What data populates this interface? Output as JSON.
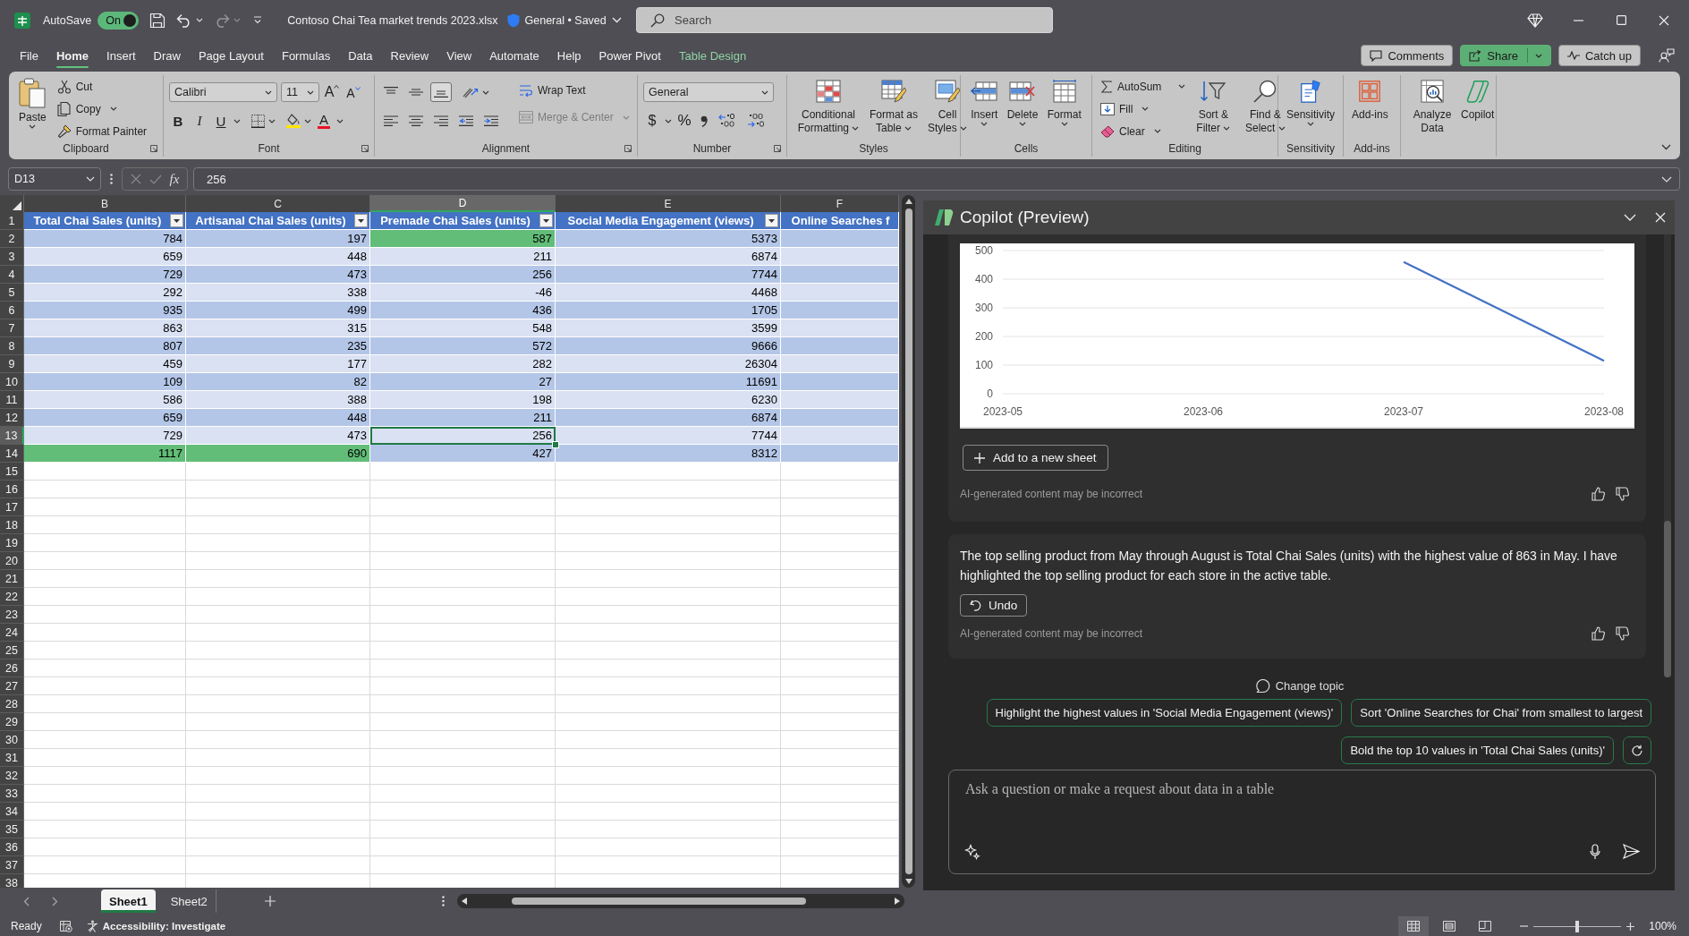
{
  "title_bar": {
    "autosave_label": "AutoSave",
    "autosave_toggle": {
      "label": "On",
      "on": true
    },
    "quick_access": [
      {
        "kind": "save",
        "disabled": false
      },
      {
        "kind": "undo",
        "disabled": false
      },
      {
        "kind": "redo",
        "disabled": true
      }
    ],
    "file_name": "Contoso Chai Tea market trends 2023.xlsx",
    "document_status": "General • Saved",
    "search": {
      "placeholder": "Search"
    }
  },
  "menu_tabs": [
    {
      "label": "File",
      "selected": false,
      "kind": "tab"
    },
    {
      "label": "Home",
      "selected": true,
      "kind": "tab"
    },
    {
      "label": "Insert",
      "selected": false,
      "kind": "tab"
    },
    {
      "label": "Draw",
      "selected": false,
      "kind": "tab"
    },
    {
      "label": "Page Layout",
      "selected": false,
      "kind": "tab"
    },
    {
      "label": "Formulas",
      "selected": false,
      "kind": "tab"
    },
    {
      "label": "Data",
      "selected": false,
      "kind": "tab"
    },
    {
      "label": "Review",
      "selected": false,
      "kind": "tab"
    },
    {
      "label": "View",
      "selected": false,
      "kind": "tab"
    },
    {
      "label": "Automate",
      "selected": false,
      "kind": "tab"
    },
    {
      "label": "Help",
      "selected": false,
      "kind": "tab"
    },
    {
      "label": "Power Pivot",
      "selected": false,
      "kind": "tab"
    },
    {
      "label": "Table Design",
      "selected": false,
      "kind": "contextual"
    }
  ],
  "header_buttons": {
    "comments": "Comments",
    "share": "Share",
    "catch_up": "Catch up"
  },
  "ribbon": {
    "clipboard": {
      "label": "Clipboard",
      "paste": "Paste",
      "cut": "Cut",
      "copy": "Copy",
      "format_painter": "Format Painter"
    },
    "font": {
      "label": "Font",
      "font_name": "Calibri",
      "font_size": "11",
      "grow_font": "A",
      "shrink_font": "A",
      "bold": "B",
      "italic": "I",
      "underline": "U",
      "font_color": "A"
    },
    "alignment": {
      "label": "Alignment",
      "vertical_align": [
        {
          "kind": "top",
          "selected": false
        },
        {
          "kind": "middle",
          "selected": false
        },
        {
          "kind": "bottom",
          "selected": true
        }
      ],
      "wrap_text": {
        "label": "Wrap Text",
        "disabled": false
      },
      "merge_center": {
        "label": "Merge & Center",
        "disabled": true
      }
    },
    "number": {
      "label": "Number",
      "format": "General",
      "currency": "$",
      "percent": "%"
    },
    "styles": {
      "label": "Styles",
      "buttons": [
        {
          "label": "Conditional Formatting",
          "kind": "conditional"
        },
        {
          "label": "Format as Table",
          "kind": "table"
        },
        {
          "label": "Cell Styles",
          "kind": "cell_styles"
        }
      ]
    },
    "cells": {
      "label": "Cells",
      "buttons": [
        {
          "label": "Insert",
          "kind": "insert"
        },
        {
          "label": "Delete",
          "kind": "delete"
        },
        {
          "label": "Format",
          "kind": "format"
        }
      ]
    },
    "editing": {
      "label": "Editing",
      "autosum": "AutoSum",
      "fill": "Fill",
      "clear": "Clear",
      "sort_filter": "Sort & Filter",
      "find_select": "Find & Select"
    },
    "sensitivity": {
      "label": "Sensitivity",
      "button": "Sensitivity"
    },
    "add_ins": {
      "label": "Add-ins",
      "button": "Add-ins"
    },
    "analysis": {
      "analyze_data": "Analyze Data",
      "copilot": "Copilot"
    }
  },
  "formula_bar": {
    "name_box": "D13",
    "function_label": "fx",
    "value": "256"
  },
  "sheet": {
    "column_letters": [
      "B",
      "C",
      "D",
      "E",
      "F"
    ],
    "header_row_number": "1",
    "headers": [
      {
        "label": "Total Chai Sales (units)",
        "filter": true
      },
      {
        "label": "Artisanal Chai Sales (units)",
        "filter": true
      },
      {
        "label": "Premade Chai Sales (units)",
        "filter": true
      },
      {
        "label": "Social Media Engagement (views)",
        "filter": true
      },
      {
        "label": "Online Searches f",
        "filter": false
      }
    ],
    "rows": [
      {
        "row_number": "2",
        "cells": [
          {
            "value": "784",
            "highlighted": false,
            "selected": false
          },
          {
            "value": "197",
            "highlighted": false,
            "selected": false
          },
          {
            "value": "587",
            "highlighted": true,
            "selected": false
          },
          {
            "value": "5373",
            "highlighted": false,
            "selected": false
          }
        ]
      },
      {
        "row_number": "3",
        "cells": [
          {
            "value": "659",
            "highlighted": false,
            "selected": false
          },
          {
            "value": "448",
            "highlighted": false,
            "selected": false
          },
          {
            "value": "211",
            "highlighted": false,
            "selected": false
          },
          {
            "value": "6874",
            "highlighted": false,
            "selected": false
          }
        ]
      },
      {
        "row_number": "4",
        "cells": [
          {
            "value": "729",
            "highlighted": false,
            "selected": false
          },
          {
            "value": "473",
            "highlighted": false,
            "selected": false
          },
          {
            "value": "256",
            "highlighted": false,
            "selected": false
          },
          {
            "value": "7744",
            "highlighted": false,
            "selected": false
          }
        ]
      },
      {
        "row_number": "5",
        "cells": [
          {
            "value": "292",
            "highlighted": false,
            "selected": false
          },
          {
            "value": "338",
            "highlighted": false,
            "selected": false
          },
          {
            "value": "-46",
            "highlighted": false,
            "selected": false
          },
          {
            "value": "4468",
            "highlighted": false,
            "selected": false
          }
        ]
      },
      {
        "row_number": "6",
        "cells": [
          {
            "value": "935",
            "highlighted": false,
            "selected": false
          },
          {
            "value": "499",
            "highlighted": false,
            "selected": false
          },
          {
            "value": "436",
            "highlighted": false,
            "selected": false
          },
          {
            "value": "1705",
            "highlighted": false,
            "selected": false
          }
        ]
      },
      {
        "row_number": "7",
        "cells": [
          {
            "value": "863",
            "highlighted": false,
            "selected": false
          },
          {
            "value": "315",
            "highlighted": false,
            "selected": false
          },
          {
            "value": "548",
            "highlighted": false,
            "selected": false
          },
          {
            "value": "3599",
            "highlighted": false,
            "selected": false
          }
        ]
      },
      {
        "row_number": "8",
        "cells": [
          {
            "value": "807",
            "highlighted": false,
            "selected": false
          },
          {
            "value": "235",
            "highlighted": false,
            "selected": false
          },
          {
            "value": "572",
            "highlighted": false,
            "selected": false
          },
          {
            "value": "9666",
            "highlighted": false,
            "selected": false
          }
        ]
      },
      {
        "row_number": "9",
        "cells": [
          {
            "value": "459",
            "highlighted": false,
            "selected": false
          },
          {
            "value": "177",
            "highlighted": false,
            "selected": false
          },
          {
            "value": "282",
            "highlighted": false,
            "selected": false
          },
          {
            "value": "26304",
            "highlighted": false,
            "selected": false
          }
        ]
      },
      {
        "row_number": "10",
        "cells": [
          {
            "value": "109",
            "highlighted": false,
            "selected": false
          },
          {
            "value": "82",
            "highlighted": false,
            "selected": false
          },
          {
            "value": "27",
            "highlighted": false,
            "selected": false
          },
          {
            "value": "11691",
            "highlighted": false,
            "selected": false
          }
        ]
      },
      {
        "row_number": "11",
        "cells": [
          {
            "value": "586",
            "highlighted": false,
            "selected": false
          },
          {
            "value": "388",
            "highlighted": false,
            "selected": false
          },
          {
            "value": "198",
            "highlighted": false,
            "selected": false
          },
          {
            "value": "6230",
            "highlighted": false,
            "selected": false
          }
        ]
      },
      {
        "row_number": "12",
        "cells": [
          {
            "value": "659",
            "highlighted": false,
            "selected": false
          },
          {
            "value": "448",
            "highlighted": false,
            "selected": false
          },
          {
            "value": "211",
            "highlighted": false,
            "selected": false
          },
          {
            "value": "6874",
            "highlighted": false,
            "selected": false
          }
        ]
      },
      {
        "row_number": "13",
        "cells": [
          {
            "value": "729",
            "highlighted": false,
            "selected": false
          },
          {
            "value": "473",
            "highlighted": false,
            "selected": false
          },
          {
            "value": "256",
            "highlighted": false,
            "selected": true
          },
          {
            "value": "7744",
            "highlighted": false,
            "selected": false
          }
        ]
      },
      {
        "row_number": "14",
        "cells": [
          {
            "value": "1117",
            "highlighted": true,
            "selected": false
          },
          {
            "value": "690",
            "highlighted": true,
            "selected": false
          },
          {
            "value": "427",
            "highlighted": false,
            "selected": false
          },
          {
            "value": "8312",
            "highlighted": false,
            "selected": false
          }
        ]
      }
    ],
    "empty_rows": [
      "15",
      "16",
      "17",
      "18",
      "19",
      "20",
      "21",
      "22",
      "23",
      "24",
      "25",
      "26",
      "27",
      "28",
      "29",
      "30",
      "31",
      "32",
      "33",
      "34",
      "35",
      "36",
      "37",
      "38"
    ]
  },
  "sheet_tabs": [
    {
      "label": "Sheet1",
      "selected": true
    },
    {
      "label": "Sheet2",
      "selected": false
    }
  ],
  "status_bar": {
    "status": "Ready",
    "accessibility": "Accessibility: Investigate",
    "views": [
      {
        "kind": "normal",
        "selected": true
      },
      {
        "kind": "page_layout",
        "selected": false
      },
      {
        "kind": "page_break",
        "selected": false
      }
    ],
    "zoom_slider": {
      "level": 0.5
    },
    "zoom_level": "100%"
  },
  "copilot": {
    "title": "Copilot (Preview)",
    "messages": [
      {
        "kind": "chart",
        "chart_data": {
          "type": "line",
          "categories": [
            "2023-05",
            "2023-06",
            "2023-07",
            "2023-08"
          ],
          "values": [
            null,
            null,
            460,
            115
          ],
          "color": "#4472c4",
          "yticks": [
            0,
            100,
            200,
            300,
            400,
            500
          ],
          "ylim": [
            0,
            525
          ],
          "grid": true
        },
        "action": "Add to a new sheet",
        "disclaimer": "AI-generated content may be incorrect"
      },
      {
        "kind": "text",
        "text": "The top selling product from May through August is Total Chai Sales (units) with the highest value of 863 in May. I have highlighted the top selling product for each store in the active table.",
        "action": "Undo",
        "disclaimer": "AI-generated content may be incorrect"
      }
    ],
    "change_topic": "Change topic",
    "suggestions": [
      "Highlight the highest values in 'Social Media Engagement (views)'",
      "Sort 'Online Searches for Chai' from smallest to largest",
      "Bold the top 10 values in 'Total Chai Sales (units)'"
    ],
    "input": {
      "placeholder": "Ask a question or make a request about data in a table"
    }
  }
}
